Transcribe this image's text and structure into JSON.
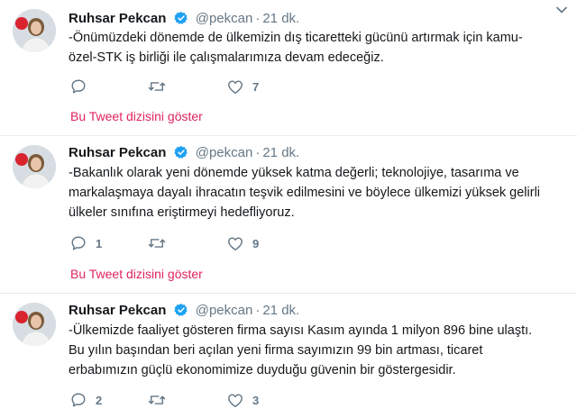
{
  "tweets": [
    {
      "name": "Ruhsar Pekcan",
      "handle": "@pekcan",
      "separator": "·",
      "time": "21 dk.",
      "text_lines": [
        "-Önümüzdeki dönemde de ülkemizin dış ticaretteki gücünü artırmak için kamu-",
        "özel-STK iş birliği ile çalışmalarımıza devam edeceğiz."
      ],
      "reply_count": "",
      "like_count": "7",
      "thread_link": "Bu Tweet dizisini göster"
    },
    {
      "name": "Ruhsar Pekcan",
      "handle": "@pekcan",
      "separator": "·",
      "time": "21 dk.",
      "text_lines": [
        "-Bakanlık olarak yeni dönemde yüksek katma değerli; teknolojiye, tasarıma ve",
        "markalaşmaya dayalı ihracatın teşvik edilmesini ve böylece ülkemizi yüksek gelirli",
        "ülkeler sınıfına eriştirmeyi hedefliyoruz."
      ],
      "reply_count": "1",
      "like_count": "9",
      "thread_link": "Bu Tweet dizisini göster"
    },
    {
      "name": "Ruhsar Pekcan",
      "handle": "@pekcan",
      "separator": "·",
      "time": "21 dk.",
      "text_lines": [
        "-Ülkemizde faaliyet gösteren firma sayısı Kasım ayında 1 milyon 896 bine ulaştı.",
        "Bu yılın başından beri açılan yeni firma sayımızın 99 bin artması, ticaret",
        "erbabımızın güçlü ekonomimize duyduğu güvenin bir göstergesidir."
      ],
      "reply_count": "2",
      "like_count": "3"
    }
  ],
  "colors": {
    "link": "#e0245e",
    "muted": "#657786",
    "verified": "#1da1f2",
    "divider": "#e6ecf0"
  },
  "icons": [
    "verified-badge-icon",
    "chevron-down-icon",
    "reply-icon",
    "retweet-icon",
    "like-icon"
  ]
}
